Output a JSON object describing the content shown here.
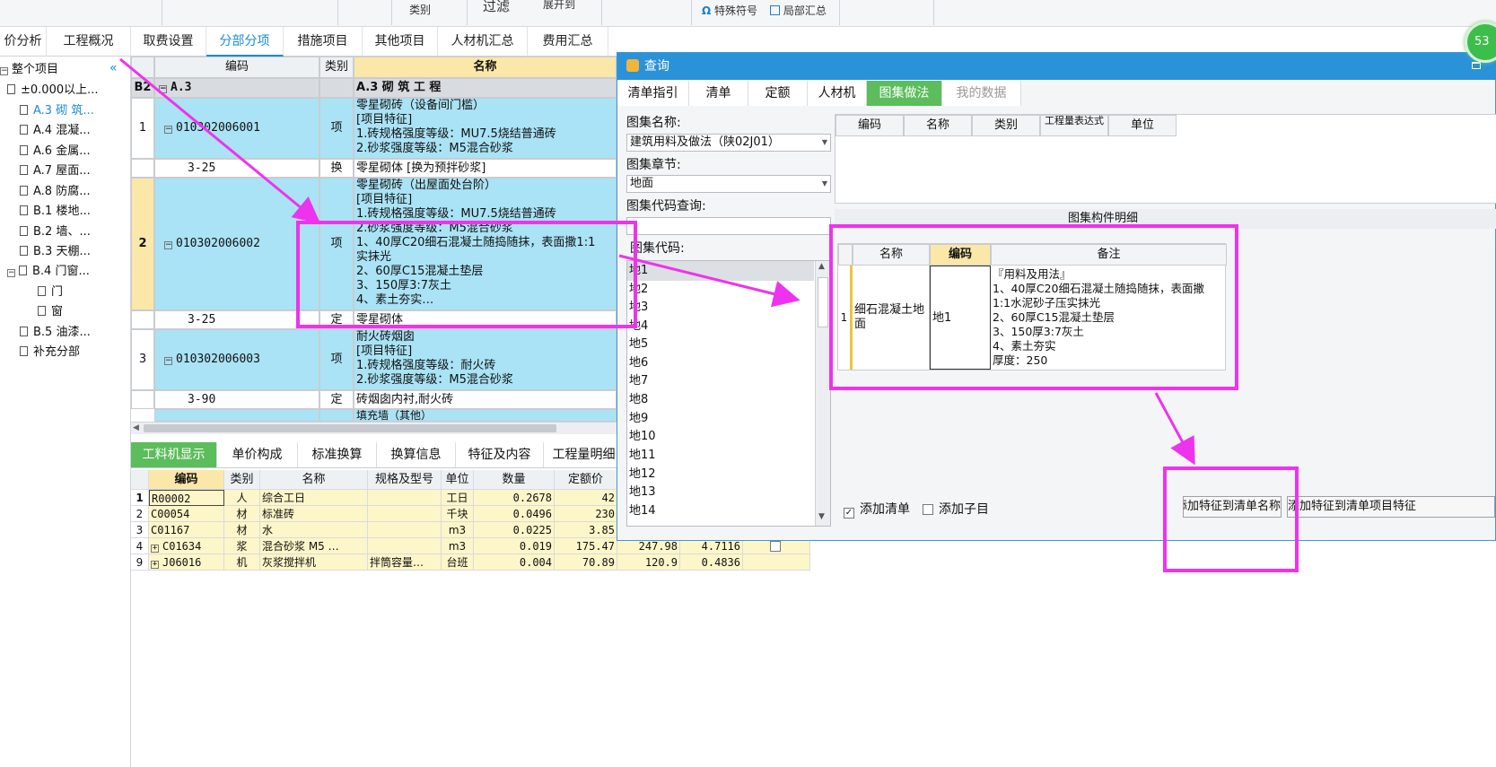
{
  "ribbon": {
    "special_symbols": "特殊符号",
    "partial_summary": "局部汇总",
    "filter": "过滤",
    "expand_to": "展开到",
    "category": "类别"
  },
  "tabs": [
    "价分析",
    "工程概况",
    "取费设置",
    "分部分项",
    "措施项目",
    "其他项目",
    "人材机汇总",
    "费用汇总"
  ],
  "tree": {
    "root": "整个项目",
    "items": [
      "±0.000以上...",
      "A.3 砌 筑...",
      "A.4 混凝...",
      "A.6 金属...",
      "A.7 屋面...",
      "A.8 防腐...",
      "B.1 楼地...",
      "B.2 墙、...",
      "B.3 天棚...",
      "B.4 门窗...",
      "门",
      "窗",
      "B.5 油漆...",
      "补充分部"
    ]
  },
  "grid": {
    "headers": {
      "code": "编码",
      "type": "类别",
      "name": "名称"
    },
    "section": {
      "rowno": "B2",
      "code": "A.3",
      "name": "A.3  砌 筑 工 程"
    },
    "rows": [
      {
        "no": "1",
        "code": "010302006001",
        "type": "项",
        "lines": [
          "零星砌砖（设备间门槛）",
          "[项目特征]",
          "1.砖规格强度等级：MU7.5烧结普通砖",
          "2.砂浆强度等级：M5混合砂浆"
        ]
      },
      {
        "no": "",
        "code": "3-25",
        "type": "换",
        "lines": [
          "零星砌体  [换为预拌砂浆]"
        ]
      },
      {
        "no": "2",
        "code": "010302006002",
        "type": "项",
        "lines": [
          "零星砌砖（出屋面处台阶）",
          "[项目特征]",
          "1.砖规格强度等级：MU7.5烧结普通砖",
          "2.砂浆强度等级：M5混合砂浆",
          "  1、40厚C20细石混凝土随捣随抹，表面撒1:1",
          "实抹光",
          "2、60厚C15混凝土垫层",
          "3、150厚3:7灰土",
          "4、素土夯实…"
        ]
      },
      {
        "no": "",
        "code": "3-25",
        "type": "定",
        "lines": [
          "零星砌体"
        ]
      },
      {
        "no": "3",
        "code": "010302006003",
        "type": "项",
        "lines": [
          "耐火砖烟囱",
          "[项目特征]",
          "1.砖规格强度等级：耐火砖",
          "2.砂浆强度等级：M5混合砂浆"
        ]
      },
      {
        "no": "",
        "code": "3-90",
        "type": "定",
        "lines": [
          "砖烟囱内衬,耐火砖"
        ]
      },
      {
        "no": "",
        "code": "",
        "type": "",
        "lines": [
          "填充墙（其他）"
        ]
      }
    ]
  },
  "bottom_tabs": [
    "工料机显示",
    "单价构成",
    "标准换算",
    "换算信息",
    "特征及内容",
    "工程量明细"
  ],
  "bottom_table": {
    "headers": [
      "编码",
      "类别",
      "名称",
      "规格及型号",
      "单位",
      "数量",
      "定额价"
    ],
    "rows": [
      {
        "no": "1",
        "code": "R00002",
        "type": "人",
        "name": "综合工日",
        "spec": "",
        "unit": "工日",
        "qty": "0.2678",
        "price": "42",
        "c8": "",
        "c9": ""
      },
      {
        "no": "2",
        "code": "C00054",
        "type": "材",
        "name": "标准砖",
        "spec": "",
        "unit": "千块",
        "qty": "0.0496",
        "price": "230",
        "c8": "",
        "c9": ""
      },
      {
        "no": "3",
        "code": "C01167",
        "type": "材",
        "name": "水",
        "spec": "",
        "unit": "m3",
        "qty": "0.0225",
        "price": "3.85",
        "c8": "",
        "c9": ""
      },
      {
        "no": "4",
        "code": "C01634",
        "type": "浆",
        "name": "混合砂浆 M5 …",
        "spec": "",
        "unit": "m3",
        "qty": "0.019",
        "price": "175.47",
        "c8": "247.98",
        "c9": "4.7116"
      },
      {
        "no": "9",
        "code": "J06016",
        "type": "机",
        "name": "灰浆搅拌机",
        "spec": "拌筒容量…",
        "unit": "台班",
        "qty": "0.004",
        "price": "70.89",
        "c8": "120.9",
        "c9": "0.4836"
      }
    ]
  },
  "dialog": {
    "title": "查询",
    "tabs": [
      "清单指引",
      "清单",
      "定额",
      "人材机",
      "图集做法",
      "我的数据"
    ],
    "atlas_name_label": "图集名称:",
    "atlas_name_value": "建筑用料及做法（陕02J01）",
    "atlas_chapter_label": "图集章节:",
    "atlas_chapter_value": "地面",
    "atlas_query_label": "图集代码查询:",
    "atlas_code_label": "图集代码:",
    "codes": [
      "地1",
      "地2",
      "地3",
      "地4",
      "地5",
      "地6",
      "地7",
      "地8",
      "地9",
      "地10",
      "地11",
      "地12",
      "地13",
      "地14"
    ],
    "top_headers": [
      "编码",
      "名称",
      "类别",
      "工程量表达式",
      "单位"
    ],
    "detail_title": "图集构件明细",
    "detail_headers": [
      "名称",
      "编码",
      "备注"
    ],
    "detail_row": {
      "no": "1",
      "name": "细石混凝土地面",
      "code": "地1",
      "remarks": [
        "『用料及用法』",
        "1、40厚C20细石混凝土随捣随抹，表面撒",
        "1:1水泥砂子压实抹光",
        "2、60厚C15混凝土垫层",
        "3、150厚3:7灰土",
        "4、素土夯实",
        "厚度：250"
      ]
    },
    "add_list_label": "添加清单",
    "add_sub_label": "添加子目",
    "btn_add_feature_name": "添加特征到清单名称",
    "btn_add_feature_item": "添加特征到清单项目特征"
  },
  "badge": "53"
}
